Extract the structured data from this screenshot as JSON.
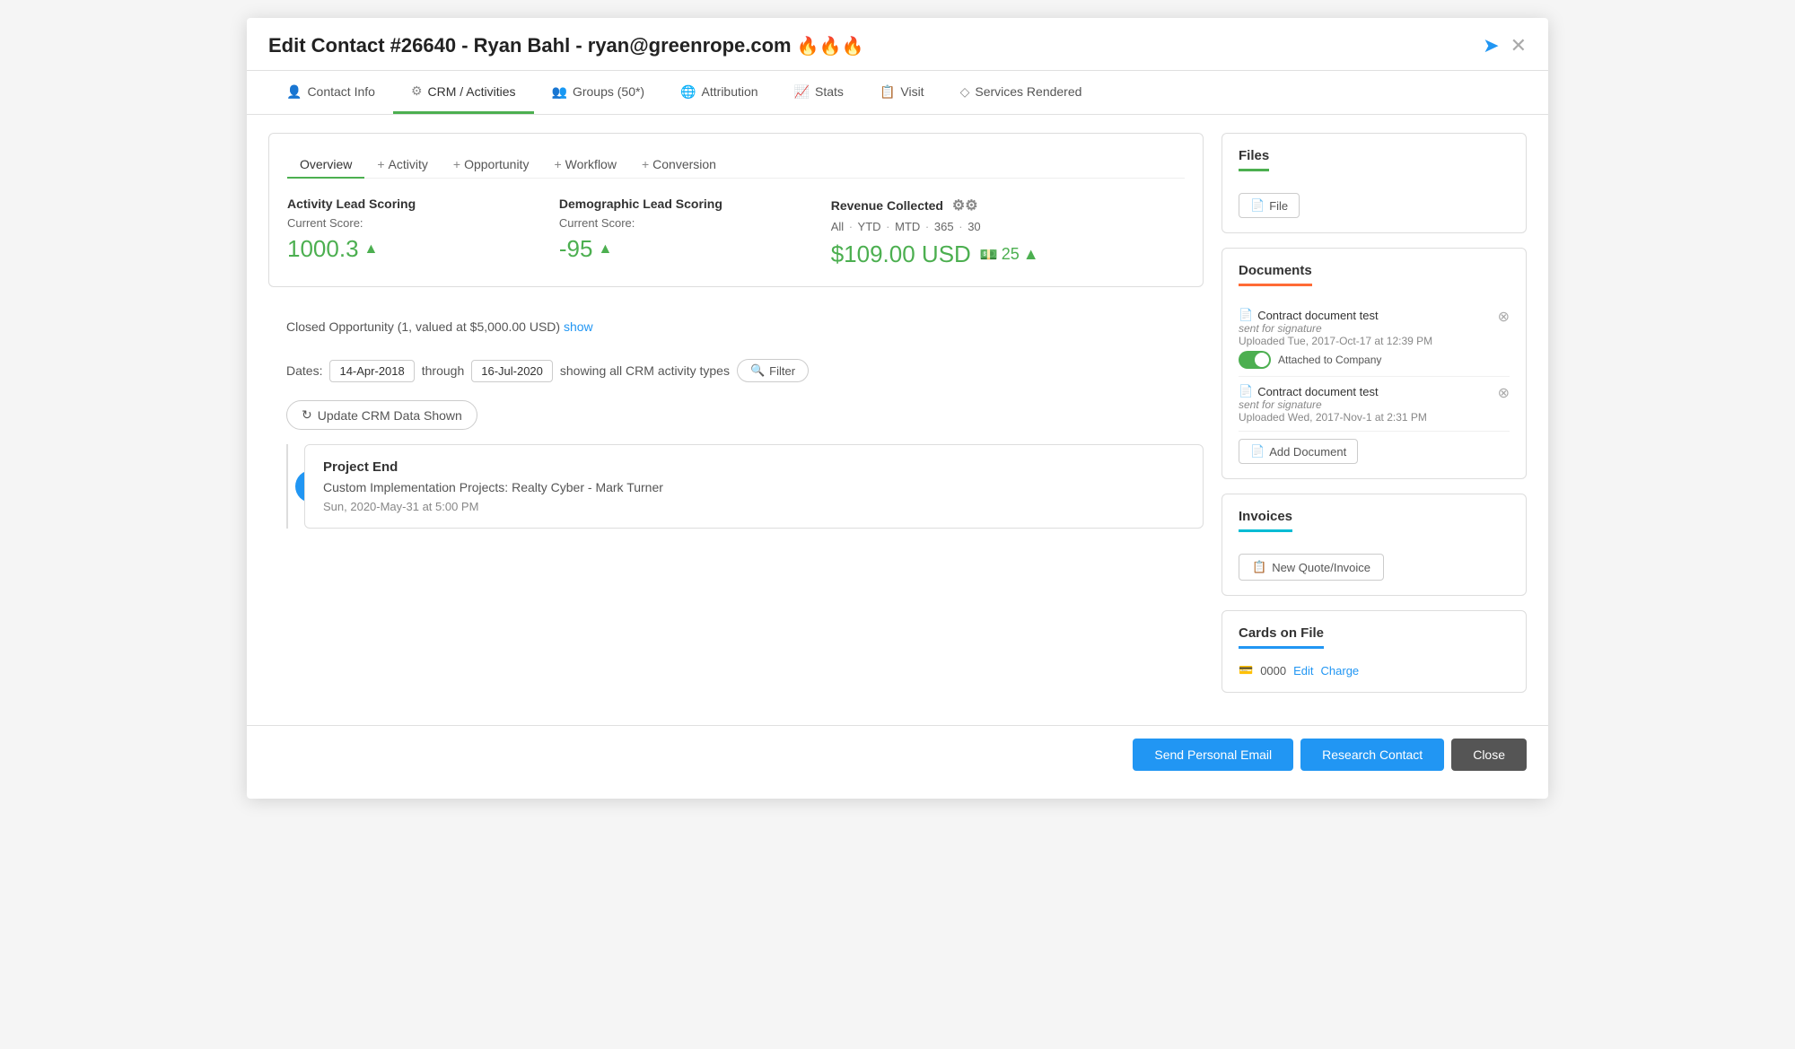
{
  "modal": {
    "title": "Edit Contact #26640 - Ryan Bahl - ryan@greenrope.com",
    "fire_emoji": "🔥🔥🔥"
  },
  "nav_tabs": [
    {
      "id": "contact-info",
      "label": "Contact Info",
      "icon": "👤",
      "active": false
    },
    {
      "id": "crm-activities",
      "label": "CRM / Activities",
      "icon": "⚙",
      "active": true
    },
    {
      "id": "groups",
      "label": "Groups (50*)",
      "icon": "👥",
      "active": false
    },
    {
      "id": "attribution",
      "label": "Attribution",
      "icon": "🌐",
      "active": false
    },
    {
      "id": "stats",
      "label": "Stats",
      "icon": "📈",
      "active": false
    },
    {
      "id": "visit",
      "label": "Visit",
      "icon": "📋",
      "active": false
    },
    {
      "id": "services-rendered",
      "label": "Services Rendered",
      "icon": "◇",
      "active": false
    }
  ],
  "overview": {
    "tabs": [
      {
        "id": "overview",
        "label": "Overview",
        "plus": false,
        "active": true
      },
      {
        "id": "activity",
        "label": "Activity",
        "plus": true,
        "active": false
      },
      {
        "id": "opportunity",
        "label": "Opportunity",
        "plus": true,
        "active": false
      },
      {
        "id": "workflow",
        "label": "Workflow",
        "plus": true,
        "active": false
      },
      {
        "id": "conversion",
        "label": "Conversion",
        "plus": true,
        "active": false
      }
    ],
    "activity_scoring": {
      "title": "Activity Lead Scoring",
      "sublabel": "Current Score:",
      "value": "1000.3"
    },
    "demographic_scoring": {
      "title": "Demographic Lead Scoring",
      "sublabel": "Current Score:",
      "value": "-95"
    },
    "revenue": {
      "title": "Revenue Collected",
      "filters": [
        "All",
        "YTD",
        "MTD",
        "365",
        "30"
      ],
      "amount": "$109.00 USD",
      "count": "25"
    }
  },
  "timeline": {
    "closed_opportunity": {
      "text": "Closed Opportunity (1, valued at $5,000.00 USD)",
      "link_text": "show"
    },
    "dates": {
      "label": "Dates:",
      "from": "14-Apr-2018",
      "through_label": "through",
      "to": "16-Jul-2020",
      "description": "showing all CRM activity types"
    },
    "filter_btn": "Filter",
    "update_btn": "Update CRM Data Shown",
    "event": {
      "title": "Project End",
      "description": "Custom Implementation Projects: Realty Cyber - Mark Turner",
      "date": "Sun, 2020-May-31 at 5:00 PM"
    }
  },
  "files_panel": {
    "title": "Files",
    "file_btn": "File"
  },
  "documents_panel": {
    "title": "Documents",
    "items": [
      {
        "name": "Contract document test",
        "sub": "sent for signature",
        "date": "Uploaded Tue, 2017-Oct-17 at 12:39 PM",
        "attached_to_company": true,
        "toggle_label": "Attached to Company"
      },
      {
        "name": "Contract document test",
        "sub": "sent for signature",
        "date": "Uploaded Wed, 2017-Nov-1 at 2:31 PM",
        "attached_to_company": false,
        "toggle_label": ""
      }
    ],
    "add_btn": "Add Document"
  },
  "invoices_panel": {
    "title": "Invoices",
    "new_btn": "New Quote/Invoice"
  },
  "cards_panel": {
    "title": "Cards on File",
    "card_number": "0000",
    "edit_label": "Edit",
    "charge_label": "Charge"
  },
  "footer": {
    "send_email_btn": "Send Personal Email",
    "research_btn": "Research Contact",
    "close_btn": "Close"
  }
}
